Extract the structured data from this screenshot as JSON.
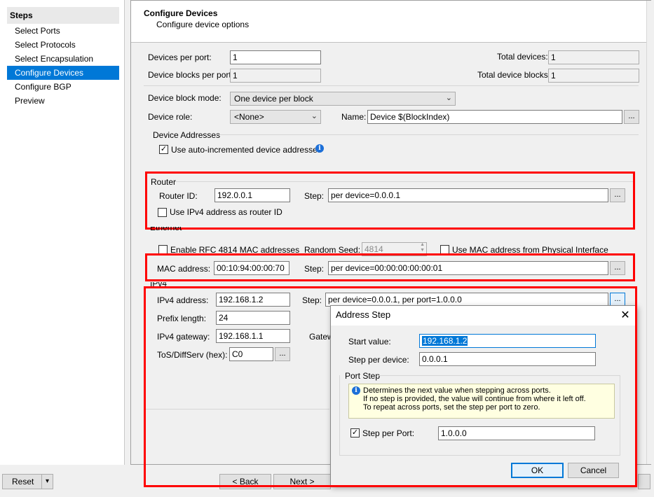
{
  "steps": {
    "header": "Steps",
    "items": [
      "Select Ports",
      "Select Protocols",
      "Select Encapsulation",
      "Configure Devices",
      "Configure BGP",
      "Preview"
    ],
    "active_index": 3
  },
  "header": {
    "title": "Configure Devices",
    "subtitle": "Configure device options"
  },
  "form": {
    "devices_per_port_label": "Devices per port:",
    "devices_per_port": "1",
    "device_blocks_per_port_label": "Device blocks per port:",
    "device_blocks_per_port": "1",
    "total_devices_label": "Total devices:",
    "total_devices": "1",
    "total_device_blocks_label": "Total device blocks:",
    "total_device_blocks": "1",
    "device_block_mode_label": "Device block mode:",
    "device_block_mode": "One device per block",
    "device_role_label": "Device role:",
    "device_role": "<None>",
    "name_label": "Name:",
    "name": "Device $(BlockIndex)",
    "ellipsis": "..."
  },
  "device_addresses": {
    "label": "Device Addresses",
    "auto_increment_label": "Use auto-incremented device addresses",
    "auto_increment_checked": true
  },
  "router": {
    "label": "Router",
    "router_id_label": "Router ID:",
    "router_id": "192.0.0.1",
    "step_label": "Step:",
    "step": "per device=0.0.0.1",
    "use_ipv4_label": "Use IPv4 address as router ID",
    "use_ipv4_checked": false
  },
  "ethernet": {
    "label": "Ethernet",
    "enable_rfc_label": "Enable RFC 4814 MAC addresses",
    "random_seed_label": "Random Seed:",
    "random_seed": "4814",
    "use_mac_physical_label": "Use MAC address from Physical Interface",
    "mac_label": "MAC address:",
    "mac": "00:10:94:00:00:70",
    "step_label": "Step:",
    "step": "per device=00:00:00:00:00:01"
  },
  "ipv4": {
    "label": "IPv4",
    "address_label": "IPv4 address:",
    "address": "192.168.1.2",
    "step_label": "Step:",
    "step": "per device=0.0.0.1, per port=1.0.0.0",
    "prefix_label": "Prefix length:",
    "prefix": "24",
    "gateway_label": "IPv4 gateway:",
    "gateway": "192.168.1.1",
    "gateway_step_partial": "Gatew",
    "tos_label": "ToS/DiffServ (hex):",
    "tos": "C0"
  },
  "bottom": {
    "reset": "Reset",
    "reset_arrow": "▾",
    "back": "< Back",
    "next": "Next >"
  },
  "dialog": {
    "title": "Address Step",
    "close": "✕",
    "start_label": "Start value:",
    "start_value": "192.168.1.2",
    "step_device_label": "Step per device:",
    "step_device": "0.0.0.1",
    "port_step_label": "Port Step",
    "info_line1": "Determines the next value when stepping across ports.",
    "info_line2": "If no step is provided, the value will continue from where it left off.",
    "info_line3": "To repeat across ports, set the step per port to zero.",
    "step_port_label": "Step per Port:",
    "step_port_checked": true,
    "step_port": "1.0.0.0",
    "ok": "OK",
    "cancel": "Cancel"
  },
  "icons": {
    "info": "info-icon",
    "dropdown": "chevron-down-icon",
    "spinner": "spinner-icon",
    "check": "check-icon"
  },
  "colors": {
    "accent": "#0078d7",
    "highlight_box": "#ff0000",
    "info_bg": "#ffffe1"
  }
}
